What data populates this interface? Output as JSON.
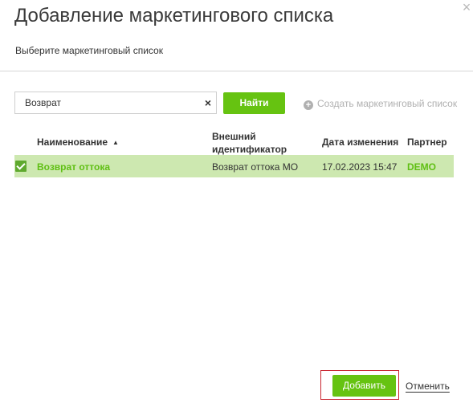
{
  "dialog": {
    "title": "Добавление маркетингового списка",
    "subtitle": "Выберите маркетинговый список",
    "close_icon": "close-icon"
  },
  "search": {
    "value": "Возврат",
    "clear_icon": "×",
    "find_label": "Найти",
    "create_label": "Создать маркетинговый список"
  },
  "table": {
    "headers": {
      "name": "Наименование",
      "external_id_line1": "Внешний",
      "external_id_line2": "идентификатор",
      "date": "Дата изменения",
      "partner": "Партнер"
    },
    "sort": {
      "column": "name",
      "direction": "ascending",
      "icon": "▲"
    },
    "rows": [
      {
        "selected": true,
        "name": "Возврат оттока",
        "external_id": "Возврат оттока МО",
        "date": "17.02.2023 15:47",
        "partner": "DEMO"
      }
    ]
  },
  "footer": {
    "add_label": "Добавить",
    "cancel_label": "Отменить"
  },
  "colors": {
    "accent": "#66c311",
    "selected_row": "#cde8b0",
    "link_green": "#5fbf13",
    "highlight_border": "#c8242e"
  }
}
